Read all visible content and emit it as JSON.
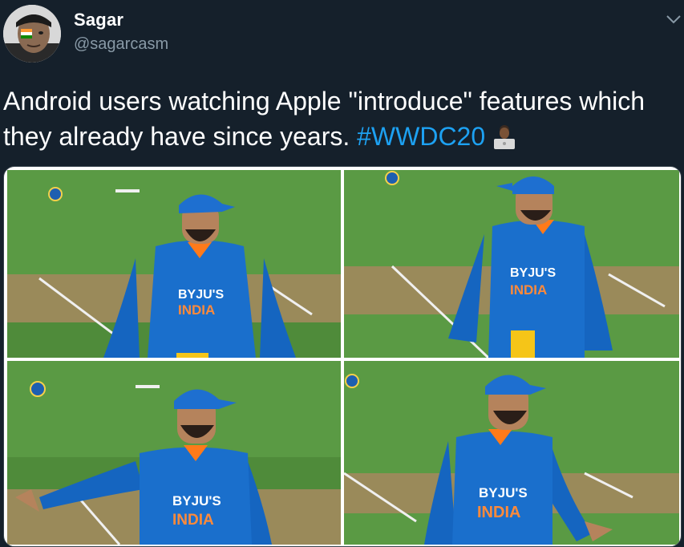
{
  "user": {
    "display_name": "Sagar",
    "handle": "@sagarcasm"
  },
  "tweet": {
    "text": "Android users watching Apple \"introduce\" features which they already have since years.",
    "hashtag": "#WWDC20",
    "emoji": "man-technologist-emoji"
  },
  "media": {
    "photos": [
      {
        "shirt_text_1": "BYJU'S",
        "shirt_text_2": "INDIA"
      },
      {
        "shirt_text_1": "BYJU'S",
        "shirt_text_2": "INDIA"
      },
      {
        "shirt_text_1": "BYJU'S",
        "shirt_text_2": "INDIA"
      },
      {
        "shirt_text_1": "BYJU'S",
        "shirt_text_2": "INDIA"
      }
    ]
  },
  "colors": {
    "background": "#15202b",
    "hashtag": "#1da1f2",
    "secondary_text": "#8899a6",
    "jersey_blue": "#1565c0",
    "cap_blue": "#1e6fd0",
    "grass": "#4f8b3a"
  }
}
